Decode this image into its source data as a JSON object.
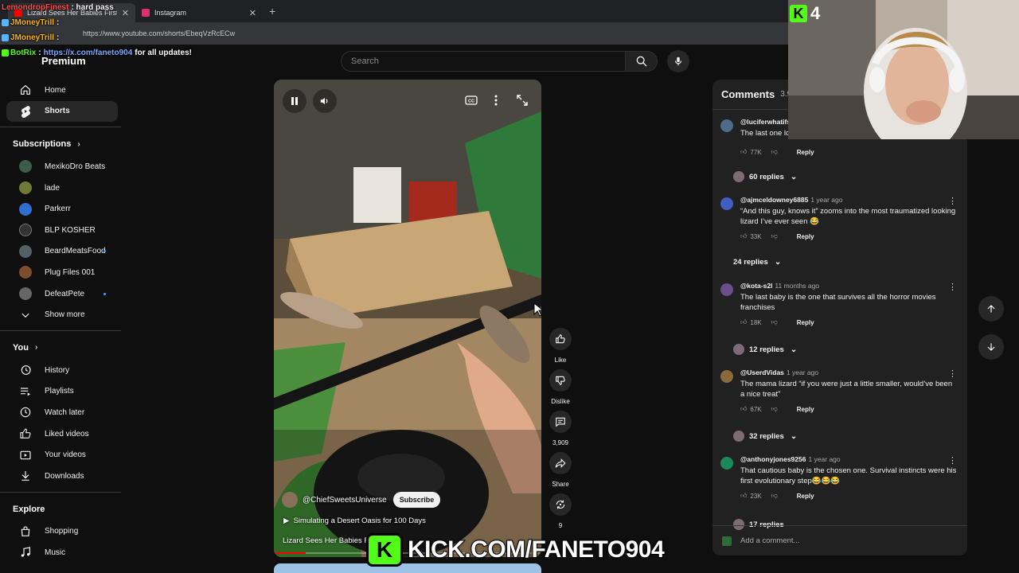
{
  "browser": {
    "tabs": [
      {
        "title": "Lizard Sees Her Babies First",
        "active": true
      },
      {
        "title": "Instagram",
        "active": false
      }
    ],
    "url": "https://www.youtube.com/shorts/EbeqVzRcECw"
  },
  "chat": [
    {
      "user": "LemondropFinest",
      "message": ": hard pass"
    },
    {
      "user": "JMoneyTrill",
      "message": ":"
    },
    {
      "user": "JMoneyTrill",
      "message": ":"
    },
    {
      "user": "BotRix",
      "message": ":",
      "link": "https://x.com/faneto904",
      "suffix": "for all updates!"
    }
  ],
  "header": {
    "logo": "Premium",
    "search_placeholder": "Search"
  },
  "sidebar": {
    "main": [
      {
        "label": "Home",
        "icon": "home-icon"
      },
      {
        "label": "Shorts",
        "icon": "shorts-icon",
        "active": true
      }
    ],
    "subscriptions_title": "Subscriptions",
    "subscriptions": [
      {
        "label": "MexikoDro Beats",
        "color": "#3b5d4a",
        "dot": false
      },
      {
        "label": "lade",
        "color": "#6f7a3a",
        "dot": false
      },
      {
        "label": "Parkerr",
        "color": "#2f6fcf",
        "dot": false
      },
      {
        "label": "BLP KOSHER",
        "color": "#333333",
        "dot": false
      },
      {
        "label": "BeardMeatsFood",
        "color": "#556066",
        "dot": true
      },
      {
        "label": "Plug Files 001",
        "color": "#7a4d2b",
        "dot": false
      },
      {
        "label": "DefeatPete",
        "color": "#666666",
        "dot": true
      }
    ],
    "show_more": "Show more",
    "you_title": "You",
    "you": [
      {
        "label": "History",
        "icon": "history-icon"
      },
      {
        "label": "Playlists",
        "icon": "playlists-icon"
      },
      {
        "label": "Watch later",
        "icon": "watch-later-icon"
      },
      {
        "label": "Liked videos",
        "icon": "like-icon"
      },
      {
        "label": "Your videos",
        "icon": "your-videos-icon"
      },
      {
        "label": "Downloads",
        "icon": "download-icon"
      }
    ],
    "explore_title": "Explore",
    "explore": [
      {
        "label": "Shopping",
        "icon": "shopping-icon"
      },
      {
        "label": "Music",
        "icon": "music-icon"
      }
    ]
  },
  "video": {
    "channel": "@ChiefSweetsUniverse",
    "subscribe": "Subscribe",
    "playlist": "Simulating a Desert Oasis for 100 Days",
    "title": "Lizard Sees Her Babies Fi",
    "progress": 0.12
  },
  "actions": [
    {
      "label": "Like",
      "icon": "thumbs-up-icon"
    },
    {
      "label": "Dislike",
      "icon": "thumbs-down-icon"
    },
    {
      "label": "3,909",
      "icon": "comment-icon"
    },
    {
      "label": "Share",
      "icon": "share-icon"
    },
    {
      "label": "9",
      "icon": "remix-icon"
    }
  ],
  "comments": {
    "title": "Comments",
    "count": "3.9",
    "items": [
      {
        "user": "@luciferwhatifs",
        "time": "",
        "text": "The last one lo",
        "likes": "77K",
        "reply": "Reply",
        "replies": "60 replies",
        "avatar": "#4f6b8a"
      },
      {
        "user": "@ajmceldowney6885",
        "time": "1 year ago",
        "text": "“And this guy, knows it” zooms into the most traumatized looking lizard I’ve ever seen 😂",
        "likes": "33K",
        "reply": "Reply",
        "replies": "24 replies",
        "avatar": "#3f5fbf"
      },
      {
        "user": "@kota-s2l",
        "time": "11 months ago",
        "text": "The last baby is the one that survives all the horror movies franchises",
        "likes": "18K",
        "reply": "Reply",
        "replies": "12 replies",
        "avatar": "#6a4f8a"
      },
      {
        "user": "@UserdVidas",
        "time": "1 year ago",
        "text": "The mama lizard “if you were just a little smaller, would’ve been a nice treat”",
        "likes": "67K",
        "reply": "Reply",
        "replies": "32 replies",
        "avatar": "#8a6a3a"
      },
      {
        "user": "@anthonyjones9256",
        "time": "1 year ago",
        "text": "That cautious baby is the chosen one. Survival instincts were his first evolutionary step😂😂😂",
        "likes": "23K",
        "reply": "Reply",
        "replies": "17 replies",
        "avatar": "#1b8a5a"
      }
    ],
    "add_placeholder": "Add a comment..."
  },
  "overlay": {
    "viewer_count": "4",
    "kick_banner": "KICK.COM/FANETO904"
  }
}
